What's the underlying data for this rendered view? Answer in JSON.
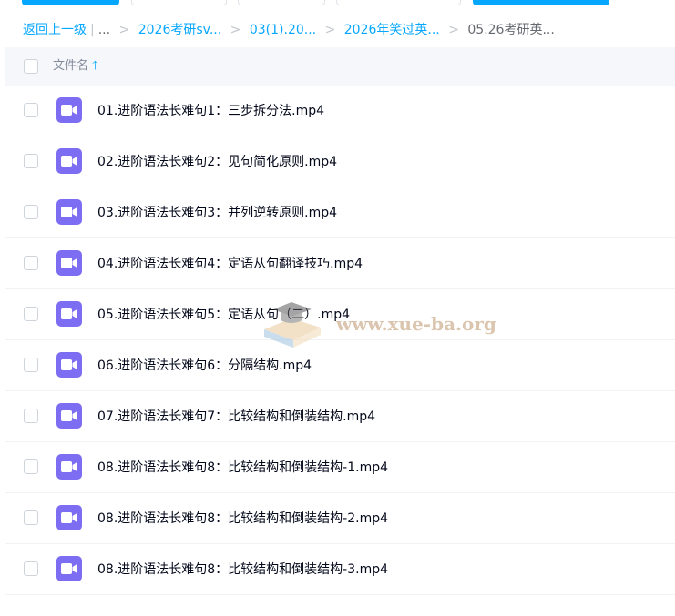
{
  "breadcrumb": {
    "back": "返回上一级",
    "bar": "|",
    "ellipsis": "...",
    "separator": ">",
    "crumbs": [
      "2026考研sv...",
      "03(1).20...",
      "2026年笑过英..."
    ],
    "current": "05.26考研英..."
  },
  "table": {
    "column_name": "文件名",
    "sort_icon": "arrow-up-icon",
    "accent_color": "#06a7ff",
    "file_icon_color": "#7d6df2",
    "rows": [
      {
        "name": "01.进阶语法长难句1：三步拆分法.mp4",
        "icon": "video-file-icon"
      },
      {
        "name": "02.进阶语法长难句2：见句简化原则.mp4",
        "icon": "video-file-icon"
      },
      {
        "name": "03.进阶语法长难句3：并列逆转原则.mp4",
        "icon": "video-file-icon"
      },
      {
        "name": "04.进阶语法长难句4：定语从句翻译技巧.mp4",
        "icon": "video-file-icon"
      },
      {
        "name": "05.进阶语法长难句5：定语从句（二）.mp4",
        "icon": "video-file-icon"
      },
      {
        "name": "06.进阶语法长难句6：分隔结构.mp4",
        "icon": "video-file-icon"
      },
      {
        "name": "07.进阶语法长难句7：比较结构和倒装结构.mp4",
        "icon": "video-file-icon"
      },
      {
        "name": "08.进阶语法长难句8：比较结构和倒装结构-1.mp4",
        "icon": "video-file-icon"
      },
      {
        "name": "08.进阶语法长难句8：比较结构和倒装结构-2.mp4",
        "icon": "video-file-icon"
      },
      {
        "name": "08.进阶语法长难句8：比较结构和倒装结构-3.mp4",
        "icon": "video-file-icon"
      }
    ]
  },
  "watermark": {
    "text": "www.xue-ba.org",
    "icon": "graduation-cap-icon"
  }
}
